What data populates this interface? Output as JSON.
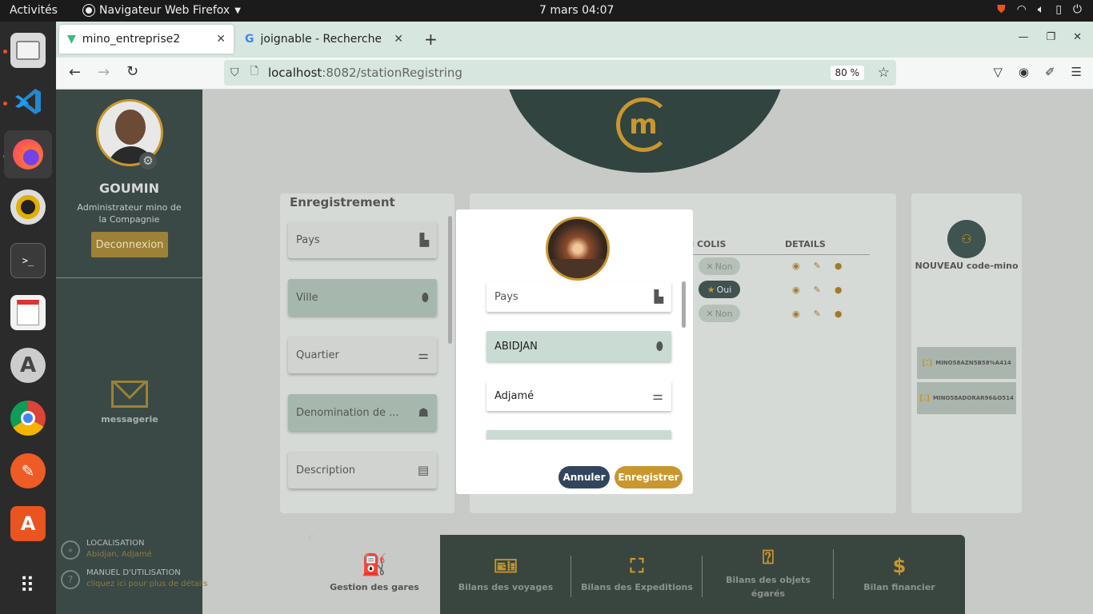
{
  "topbar": {
    "activities": "Activités",
    "app_name": "Navigateur Web Firefox",
    "clock": "7 mars  04:07"
  },
  "browser": {
    "tabs": [
      {
        "label": "mino_entreprise2"
      },
      {
        "label": "joignable - Recherche Go"
      }
    ],
    "url_host": "localhost",
    "url_path": ":8082/stationRegistring",
    "zoom": "80 %"
  },
  "sidebar": {
    "user_name": "GOUMIN",
    "user_role": "Administrateur mino de la Compagnie",
    "logout_label": "Deconnexion",
    "messaging_label": "messagerie",
    "location_title": "LOCALISATION",
    "location_value": "Abidjan, Adjamé",
    "manual_title": "MANUEL D'UTILISATION",
    "manual_hint": "cliquez ici pour plus de détails"
  },
  "registration": {
    "title": "Enregistrement",
    "fields": [
      {
        "label": "Pays",
        "icon": "building-icon"
      },
      {
        "label": "Ville",
        "icon": "location-pin-icon"
      },
      {
        "label": "Quartier",
        "icon": "tune-icon"
      },
      {
        "label": "Denomination de ...",
        "icon": "robot-icon"
      },
      {
        "label": "Description",
        "icon": "comment-icon"
      }
    ]
  },
  "table": {
    "headers": [
      "TION COLIS",
      "DETAILS"
    ],
    "rows": [
      {
        "status": "Non",
        "active": false
      },
      {
        "status": "Oui",
        "active": true
      },
      {
        "status": "Non",
        "active": false
      }
    ]
  },
  "right_panel": {
    "new_code_label": "NOUVEAU code-mino",
    "codes": [
      "MINO58AZN5B58%A414",
      "MINO58ADORAR96&O514"
    ]
  },
  "modal": {
    "fields": [
      {
        "label": "Pays",
        "icon": "building-icon"
      },
      {
        "label": "ABIDJAN",
        "icon": "location-pin-icon"
      },
      {
        "label": "Adjamé",
        "icon": "tune-icon"
      }
    ],
    "cancel_label": "Annuler",
    "save_label": "Enregistrer"
  },
  "bottom_nav": [
    {
      "label": "Gestion des gares",
      "active": true
    },
    {
      "label": "Bilans des voyages",
      "active": false
    },
    {
      "label": "Bilans des Expeditions",
      "active": false
    },
    {
      "label": "Bilans des objets égarés",
      "active": false
    },
    {
      "label": "Bilan financier",
      "active": false
    }
  ],
  "colors": {
    "gold": "#c9972e",
    "dark_teal": "#3a4946",
    "teal_light": "#a6b8ad",
    "navy": "#33455c"
  }
}
